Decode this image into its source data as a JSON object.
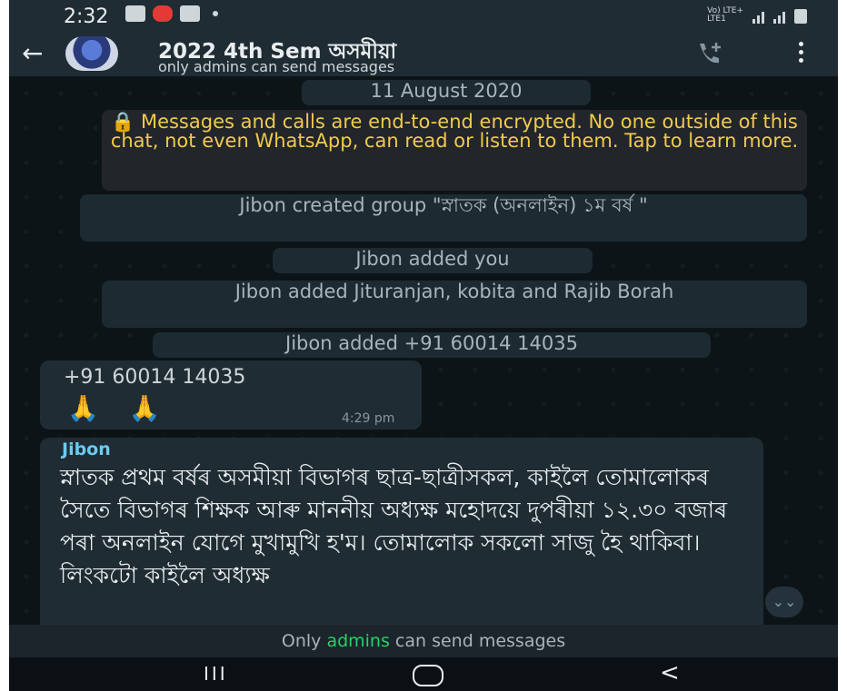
{
  "status_bar": {
    "time": "2:32",
    "network_label": "Vo) LTE+\nLTE1"
  },
  "app_bar": {
    "back_icon": "arrow-left-icon",
    "group_name": "2022 4th Sem অসমীয়া",
    "subtitle": "only admins can send messages",
    "call_icon": "add-call-icon",
    "menu_icon": "more-vertical-icon"
  },
  "chat": {
    "date_chip": "11 August 2020",
    "encryption_notice": "🔒 Messages and calls are end-to-end encrypted. No one outside of this chat, not even WhatsApp, can read or listen to them. Tap to learn more.",
    "system_messages": [
      "Jibon created group \"স্নাতক (অনলাইন) ১ম বৰ্ষ \"",
      "Jibon added you",
      "Jibon added Jituranjan, kobita and Rajib Borah",
      "Jibon added +91 60014 14035"
    ],
    "messages": [
      {
        "sender": "+91 60014 14035",
        "text": "🙏 🙏",
        "time": "4:29 pm"
      },
      {
        "sender": "Jibon",
        "text": "স্নাতক প্ৰথম বৰ্ষৰ অসমীয়া বিভাগৰ ছাত্ৰ-ছাত্ৰীসকল, কাইলৈ তোমালোকৰ সৈতে বিভাগৰ শিক্ষক আৰু মাননীয় অধ্যক্ষ মহোদয়ে দুপৰীয়া ১২.৩০ বজাৰ পৰা অনলাইন যোগে মুখামুখি হ'ম। তোমালোক সকলো সাজু হৈ থাকিবা। লিংকটো কাইলৈ অধ্যক্ষ"
      }
    ],
    "scroll_icon": "double-chevron-down-icon"
  },
  "footer": {
    "prefix": "Only",
    "highlight": "admins",
    "suffix": "can send messages",
    "highlight_color": "#25d366"
  },
  "nav_bar": {
    "recent_icon": "recent-apps-icon",
    "home_icon": "home-icon",
    "back_icon": "nav-back-icon"
  }
}
